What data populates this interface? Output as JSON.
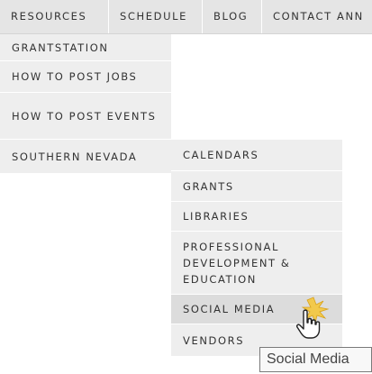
{
  "navbar": {
    "items": [
      {
        "label": "RESOURCES"
      },
      {
        "label": "SCHEDULE"
      },
      {
        "label": "BLOG"
      },
      {
        "label": "CONTACT ANN"
      }
    ]
  },
  "dropdown": {
    "items": [
      {
        "label": "GRANTSTATION"
      },
      {
        "label": "HOW TO POST JOBS"
      },
      {
        "label": "HOW TO POST EVENTS"
      },
      {
        "label": "SOUTHERN NEVADA"
      }
    ]
  },
  "submenu": {
    "items": [
      {
        "label": "CALENDARS"
      },
      {
        "label": "GRANTS"
      },
      {
        "label": "LIBRARIES"
      },
      {
        "label": "PROFESSIONAL DEVELOPMENT & EDUCATION"
      },
      {
        "label": "SOCIAL MEDIA"
      },
      {
        "label": "VENDORS"
      }
    ]
  },
  "tooltip": {
    "text": "Social Media"
  },
  "cursor": {
    "icon": "hand-pointer-icon"
  },
  "colors": {
    "menu_bg": "#eeeeee",
    "navbar_bg": "#e5e5e5",
    "hover_bg": "#dcdcdc",
    "text": "#333333",
    "sparkle": "#f2c94c"
  }
}
